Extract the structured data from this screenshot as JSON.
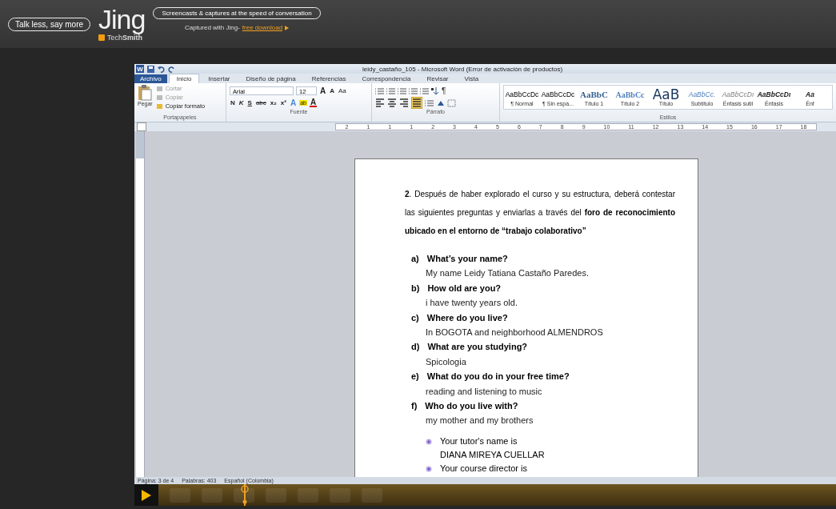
{
  "banner": {
    "slogan": "Talk less, say more",
    "logo": "Jing",
    "vendor": "Tech**Smith**",
    "tagline": "Screencasts & captures at the speed of conversation",
    "captured_text": "Captured with Jing-",
    "download_link": "free download"
  },
  "word": {
    "logo": "W",
    "title": "leidy_castaño_105  -  Microsoft Word (Error de activación de productos)",
    "tabs": [
      {
        "label": "Archivo",
        "kind": "file",
        "selected": false
      },
      {
        "label": "Inicio",
        "kind": "tab",
        "selected": true
      },
      {
        "label": "Insertar",
        "kind": "tab",
        "selected": false
      },
      {
        "label": "Diseño de página",
        "kind": "tab",
        "selected": false
      },
      {
        "label": "Referencias",
        "kind": "tab",
        "selected": false
      },
      {
        "label": "Correspondencia",
        "kind": "tab",
        "selected": false
      },
      {
        "label": "Revisar",
        "kind": "tab",
        "selected": false
      },
      {
        "label": "Vista",
        "kind": "tab",
        "selected": false
      }
    ],
    "clipboard": {
      "paste": "Pegar",
      "items": [
        {
          "label": "Cortar",
          "disabled": true
        },
        {
          "label": "Copiar",
          "disabled": true
        },
        {
          "label": "Copiar formato",
          "disabled": false
        }
      ],
      "group_label": "Portapapeles"
    },
    "font": {
      "font_name": "Arial",
      "font_size": "12",
      "size_buttons": [
        {
          "label": "A",
          "kind": "grow"
        },
        {
          "label": "A",
          "kind": "shrink"
        },
        {
          "label": "Aa",
          "kind": "case"
        }
      ],
      "format_buttons": [
        {
          "label": "N",
          "kind": "bold"
        },
        {
          "label": "K",
          "kind": "italic"
        },
        {
          "label": "S",
          "kind": "underline"
        },
        {
          "label": "abc",
          "kind": "strike"
        },
        {
          "label": "x₂",
          "kind": "sub"
        },
        {
          "label": "x²",
          "kind": "sup"
        },
        {
          "label": "A",
          "kind": "effects"
        },
        {
          "label": "ab",
          "kind": "highlight"
        },
        {
          "label": "A",
          "kind": "color"
        }
      ],
      "group_label": "Fuente"
    },
    "paragraph": {
      "pilcrow": "¶",
      "alignments": [
        {
          "selected": false
        },
        {
          "selected": false
        },
        {
          "selected": false
        },
        {
          "selected": true
        }
      ],
      "group_label": "Párrafo"
    },
    "styles": {
      "items": [
        {
          "preview": "AaBbCcDc",
          "label": "¶ Normal",
          "kind": "normal"
        },
        {
          "preview": "AaBbCcDc",
          "label": "¶ Sin espa...",
          "kind": "normal"
        },
        {
          "preview": "AaBbC",
          "label": "Título 1",
          "kind": "heading1"
        },
        {
          "preview": "AaBbCc",
          "label": "Título 2",
          "kind": "heading2"
        },
        {
          "preview": "AaB",
          "label": "Título",
          "kind": "title"
        },
        {
          "preview": "AaBbCc.",
          "label": "Subtítulo",
          "kind": "subtitle"
        },
        {
          "preview": "AaBbCcDı",
          "label": "Énfasis sutil",
          "kind": "subtle"
        },
        {
          "preview": "AaBbCcDı",
          "label": "Énfasis",
          "kind": "emphasis"
        },
        {
          "preview": "Aa",
          "label": "Énf",
          "kind": "emphasis"
        }
      ],
      "group_label": "Estilos"
    },
    "ruler_labels": [
      "2",
      "1",
      "1",
      "1",
      "2",
      "3",
      "4",
      "5",
      "6",
      "7",
      "8",
      "9",
      "10",
      "11",
      "12",
      "13",
      "14",
      "15",
      "16",
      "17",
      "18"
    ],
    "document": {
      "intro": "**2**. Después de haber explorado el curso y su estructura, deberá contestar las siguientes preguntas y enviarlas a través del **foro de reconocimiento ubicado en el entorno de “trabajo colaborativo”**",
      "questions": [
        {
          "letter": "a)",
          "question": "What’s your name?",
          "answer": "My name Leidy Tatiana Castaño Paredes."
        },
        {
          "letter": "b)",
          "question": "How old are you?",
          "answer": "i have twenty years old."
        },
        {
          "letter": "c)",
          "question": "Where do you live?",
          "answer": "In BOGOTA and neighborhood ALMENDROS"
        },
        {
          "letter": "d)",
          "question": "What are you studying?",
          "answer": "Spicologia"
        },
        {
          "letter": "e)",
          "question": "What do you do in your free time?",
          "answer": "reading and listening to music"
        },
        {
          "letter": "f)",
          "question": "Who do you live with?",
          "answer": "my mother and my brothers"
        }
      ],
      "bullets": [
        {
          "lines": [
            "Your tutor's name is",
            "DIANA MIREYA CUELLAR"
          ]
        },
        {
          "lines": [
            "Your course director is"
          ]
        }
      ]
    },
    "status_bar": [
      "Página: 3 de 4",
      "Palabras: 403",
      "Español (Colombia)"
    ]
  }
}
